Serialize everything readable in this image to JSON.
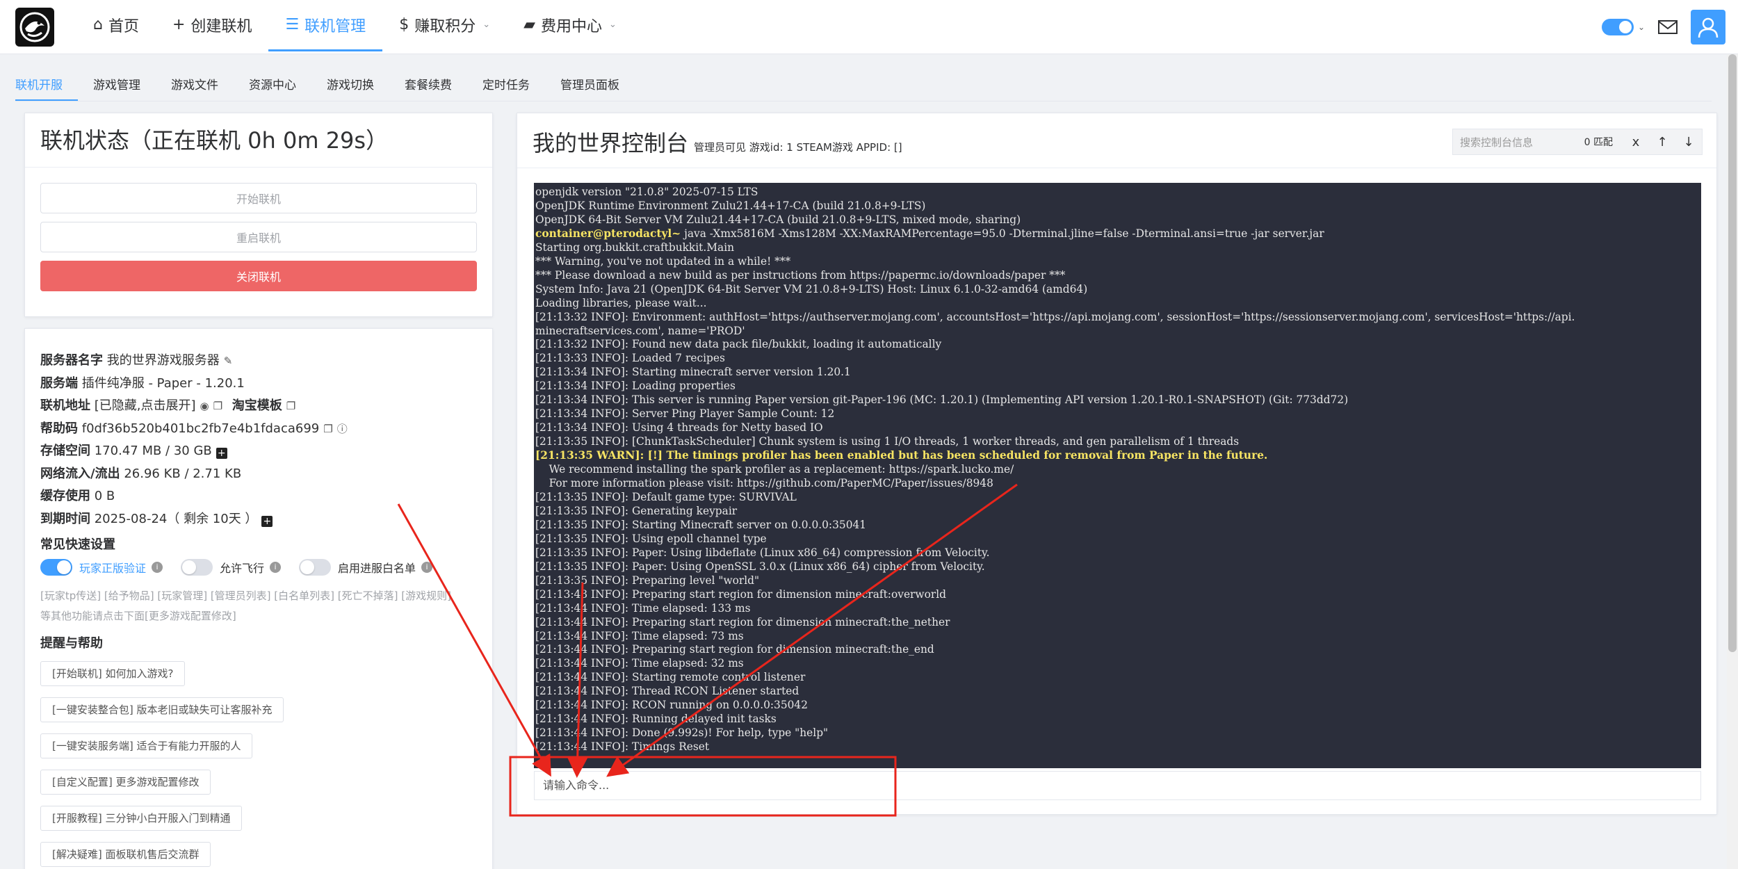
{
  "nav": {
    "items": [
      {
        "icon": "home-icon",
        "glyph": "⌂",
        "label": "首页",
        "active": false,
        "dropdown": false
      },
      {
        "icon": "plus-icon",
        "glyph": "+",
        "label": "创建联机",
        "active": false,
        "dropdown": false
      },
      {
        "icon": "database-icon",
        "glyph": "☰",
        "label": "联机管理",
        "active": true,
        "dropdown": false
      },
      {
        "icon": "dollar-icon",
        "glyph": "$",
        "label": "赚取积分",
        "active": false,
        "dropdown": true
      },
      {
        "icon": "bag-icon",
        "glyph": "▰",
        "label": "费用中心",
        "active": false,
        "dropdown": true
      }
    ]
  },
  "subtabs": [
    "联机开服",
    "游戏管理",
    "游戏文件",
    "资源中心",
    "游戏切换",
    "套餐续费",
    "定时任务",
    "管理员面板"
  ],
  "status": {
    "title": "联机状态（正在联机 0h 0m 29s）",
    "start_label": "开始联机",
    "restart_label": "重启联机",
    "stop_label": "关闭联机"
  },
  "info": {
    "server_name_label": "服务器名字",
    "server_name": "我的世界游戏服务器",
    "server_type_label": "服务端",
    "server_type": "插件纯净服 - Paper - 1.20.1",
    "address_label": "联机地址",
    "address": "[已隐藏,点击展开]",
    "taobao_label": "淘宝模板",
    "help_code_label": "帮助码",
    "help_code": "f0df36b520b401bc2fb7e4b1fdaca699",
    "storage_label": "存储空间",
    "storage": "170.47 MB / 30 GB",
    "network_label": "网络流入/流出",
    "network": "26.96 KB / 2.71 KB",
    "cache_label": "缓存使用",
    "cache": "0 B",
    "expiry_label": "到期时间",
    "expiry": "2025-08-24（ 剩余 10天 ）"
  },
  "quick": {
    "title": "常见快速设置",
    "switches": [
      {
        "label": "玩家正版验证",
        "on": true
      },
      {
        "label": "允许飞行",
        "on": false
      },
      {
        "label": "启用进服白名单",
        "on": false
      }
    ],
    "links_line1": "[玩家tp传送] [给予物品] [玩家管理] [管理员列表] [白名单列表] [死亡不掉落] [游戏规则]",
    "links_line2": "等其他功能请点击下面[更多游戏配置修改]"
  },
  "help": {
    "title": "提醒与帮助",
    "items": [
      "[开始联机] 如何加入游戏?",
      "[一键安装整合包] 版本老旧或缺失可让客服补充",
      "[一键安装服务端] 适合于有能力开服的人",
      "[自定义配置] 更多游戏配置修改",
      "[开服教程] 三分钟小白开服入门到精通",
      "[解决疑难] 面板联机售后交流群"
    ]
  },
  "console": {
    "title": "我的世界控制台",
    "subtitle": "管理员可见 游戏id: 1 STEAM游戏 APPID: []",
    "search_placeholder": "搜索控制台信息",
    "match_count": "0 匹配",
    "close_glyph": "x",
    "up_glyph": "↑",
    "down_glyph": "↓",
    "command_placeholder": "请输入命令...",
    "lines": [
      {
        "t": "openjdk version \"21.0.8\" 2025-07-15 LTS"
      },
      {
        "t": "OpenJDK Runtime Environment Zulu21.44+17-CA (build 21.0.8+9-LTS)"
      },
      {
        "t": "OpenJDK 64-Bit Server VM Zulu21.44+17-CA (build 21.0.8+9-LTS, mixed mode, sharing)"
      },
      {
        "prompt": "container@pterodactyl~",
        "t": " java -Xmx5816M -Xms128M -XX:MaxRAMPercentage=95.0 -Dterminal.jline=false -Dterminal.ansi=true -jar server.jar"
      },
      {
        "t": "Starting org.bukkit.craftbukkit.Main"
      },
      {
        "t": "*** Warning, you've not updated in a while! ***"
      },
      {
        "t": "*** Please download a new build as per instructions from https://papermc.io/downloads/paper ***"
      },
      {
        "t": "System Info: Java 21 (OpenJDK 64-Bit Server VM 21.0.8+9-LTS) Host: Linux 6.1.0-32-amd64 (amd64)"
      },
      {
        "t": "Loading libraries, please wait..."
      },
      {
        "t": "[21:13:32 INFO]: Environment: authHost='https://authserver.mojang.com', accountsHost='https://api.mojang.com', sessionHost='https://sessionserver.mojang.com', servicesHost='https://api."
      },
      {
        "t": "minecraftservices.com', name='PROD'"
      },
      {
        "t": "[21:13:32 INFO]: Found new data pack file/bukkit, loading it automatically"
      },
      {
        "t": "[21:13:33 INFO]: Loaded 7 recipes"
      },
      {
        "t": "[21:13:34 INFO]: Starting minecraft server version 1.20.1"
      },
      {
        "t": "[21:13:34 INFO]: Loading properties"
      },
      {
        "t": "[21:13:34 INFO]: This server is running Paper version git-Paper-196 (MC: 1.20.1) (Implementing API version 1.20.1-R0.1-SNAPSHOT) (Git: 773dd72)"
      },
      {
        "t": "[21:13:34 INFO]: Server Ping Player Sample Count: 12"
      },
      {
        "t": "[21:13:34 INFO]: Using 4 threads for Netty based IO"
      },
      {
        "t": "[21:13:35 INFO]: [ChunkTaskScheduler] Chunk system is using 1 I/O threads, 1 worker threads, and gen parallelism of 1 threads"
      },
      {
        "warn": true,
        "t": "[21:13:35 WARN]: [!] The timings profiler has been enabled but has been scheduled for removal from Paper in the future."
      },
      {
        "t": "    We recommend installing the spark profiler as a replacement: https://spark.lucko.me/"
      },
      {
        "t": "    For more information please visit: https://github.com/PaperMC/Paper/issues/8948"
      },
      {
        "t": "[21:13:35 INFO]: Default game type: SURVIVAL"
      },
      {
        "t": "[21:13:35 INFO]: Generating keypair"
      },
      {
        "t": "[21:13:35 INFO]: Starting Minecraft server on 0.0.0.0:35041"
      },
      {
        "t": "[21:13:35 INFO]: Using epoll channel type"
      },
      {
        "t": "[21:13:35 INFO]: Paper: Using libdeflate (Linux x86_64) compression from Velocity."
      },
      {
        "t": "[21:13:35 INFO]: Paper: Using OpenSSL 3.0.x (Linux x86_64) cipher from Velocity."
      },
      {
        "t": "[21:13:35 INFO]: Preparing level \"world\""
      },
      {
        "t": "[21:13:43 INFO]: Preparing start region for dimension minecraft:overworld"
      },
      {
        "t": "[21:13:44 INFO]: Time elapsed: 133 ms"
      },
      {
        "t": "[21:13:44 INFO]: Preparing start region for dimension minecraft:the_nether"
      },
      {
        "t": "[21:13:44 INFO]: Time elapsed: 73 ms"
      },
      {
        "t": "[21:13:44 INFO]: Preparing start region for dimension minecraft:the_end"
      },
      {
        "t": "[21:13:44 INFO]: Time elapsed: 32 ms"
      },
      {
        "t": "[21:13:44 INFO]: Starting remote control listener"
      },
      {
        "t": "[21:13:44 INFO]: Thread RCON Listener started"
      },
      {
        "t": "[21:13:44 INFO]: RCON running on 0.0.0.0:35042"
      },
      {
        "t": "[21:13:44 INFO]: Running delayed init tasks"
      },
      {
        "t": "[21:13:44 INFO]: Done (9.992s)! For help, type \"help\""
      },
      {
        "t": "[21:13:44 INFO]: Timings Reset"
      }
    ]
  },
  "colors": {
    "accent": "#409eff",
    "danger": "#ee6666",
    "terminal_bg": "#2b2e3b",
    "warn_text": "#f7e463",
    "annotation": "#e8251c"
  }
}
